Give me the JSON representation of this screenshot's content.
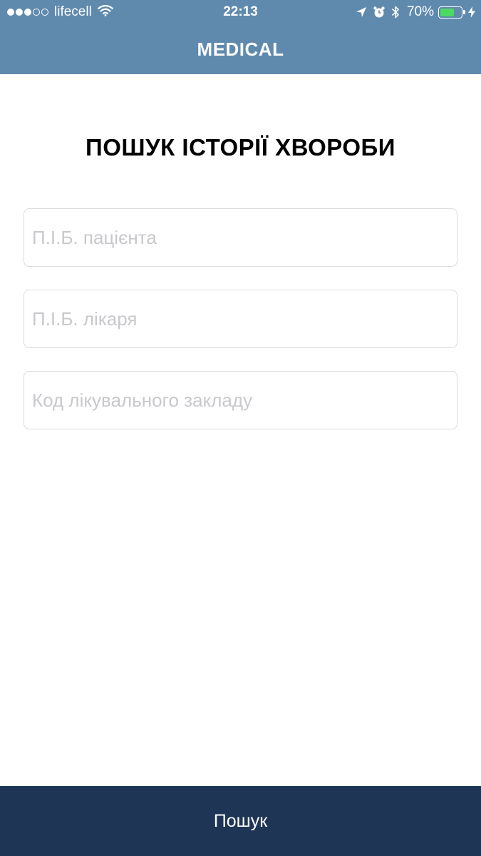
{
  "status_bar": {
    "signal_bars_filled": 3,
    "signal_bars_total": 5,
    "carrier": "lifecell",
    "time": "22:13",
    "battery_percent": "70%",
    "battery_level": 0.7,
    "icons": [
      "signal-dots-icon",
      "wifi-icon",
      "location-arrow-icon",
      "alarm-icon",
      "bluetooth-icon",
      "battery-icon",
      "charging-bolt-icon"
    ]
  },
  "nav": {
    "title": "MEDICAL"
  },
  "main": {
    "heading": "ПОШУК ІСТОРІЇ ХВОРОБИ",
    "fields": [
      {
        "name": "patient-name-input",
        "value": "",
        "placeholder": "П.І.Б. пацієнта"
      },
      {
        "name": "doctor-name-input",
        "value": "",
        "placeholder": "П.І.Б. лікаря"
      },
      {
        "name": "facility-code-input",
        "value": "",
        "placeholder": "Код лікувального закладу"
      }
    ]
  },
  "footer": {
    "search_button_label": "Пошук"
  },
  "colors": {
    "nav_bar": "#5f8aae",
    "footer_button": "#1e3556",
    "battery_fill": "#4cd964",
    "placeholder_text": "#c8c8cd",
    "field_border": "#dcdcdc"
  }
}
